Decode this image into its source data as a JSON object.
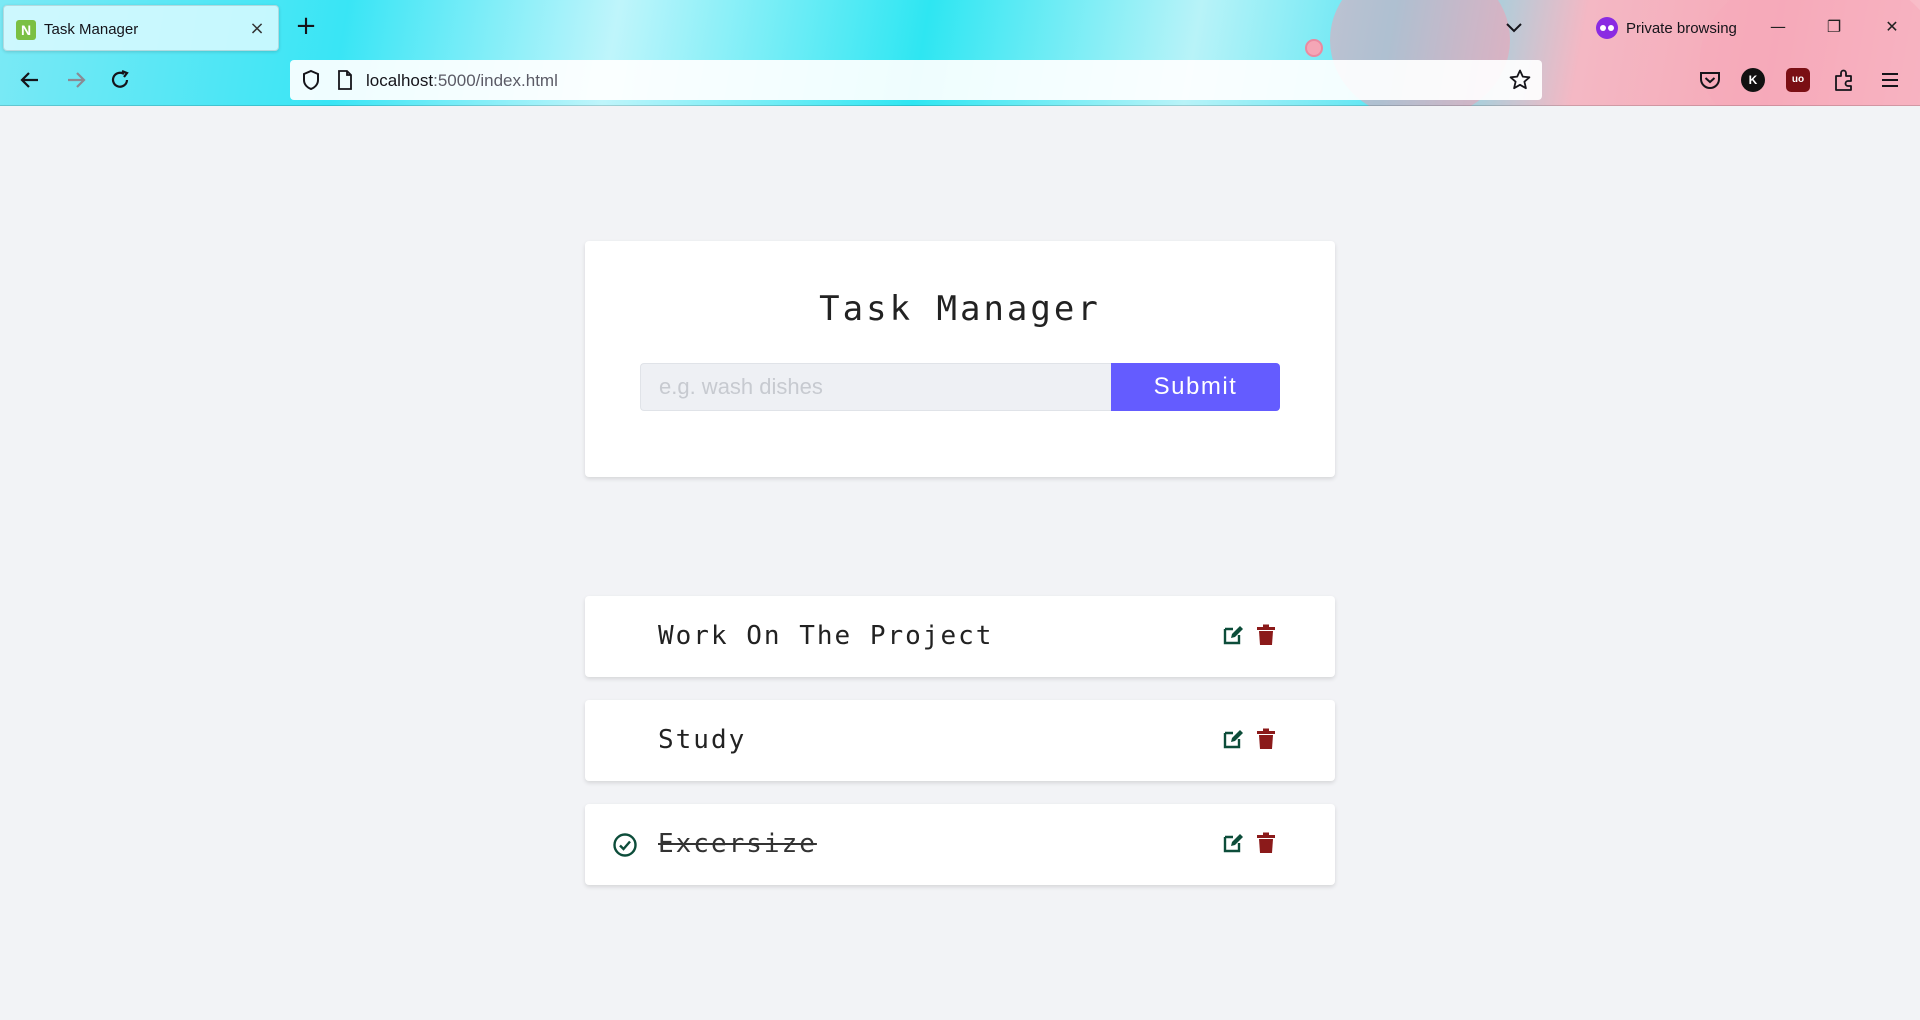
{
  "browser": {
    "tab": {
      "title": "Task Manager",
      "favicon_letter": "N"
    },
    "private_label": "Private browsing",
    "url": {
      "host": "localhost",
      "path": ":5000/index.html"
    },
    "toolbar_avatar_letter": "K",
    "ublock_label": "uo"
  },
  "form": {
    "title": "Task Manager",
    "input_placeholder": "e.g. wash dishes",
    "input_value": "",
    "submit_label": "Submit"
  },
  "tasks": [
    {
      "name": "Work On The Project",
      "completed": false
    },
    {
      "name": "Study",
      "completed": false
    },
    {
      "name": "Excersize",
      "completed": true
    }
  ],
  "colors": {
    "accent": "#645cff",
    "edit_icon": "#0d4d3a",
    "delete_icon": "#8b1a1a",
    "check_icon": "#0d4d3a"
  }
}
